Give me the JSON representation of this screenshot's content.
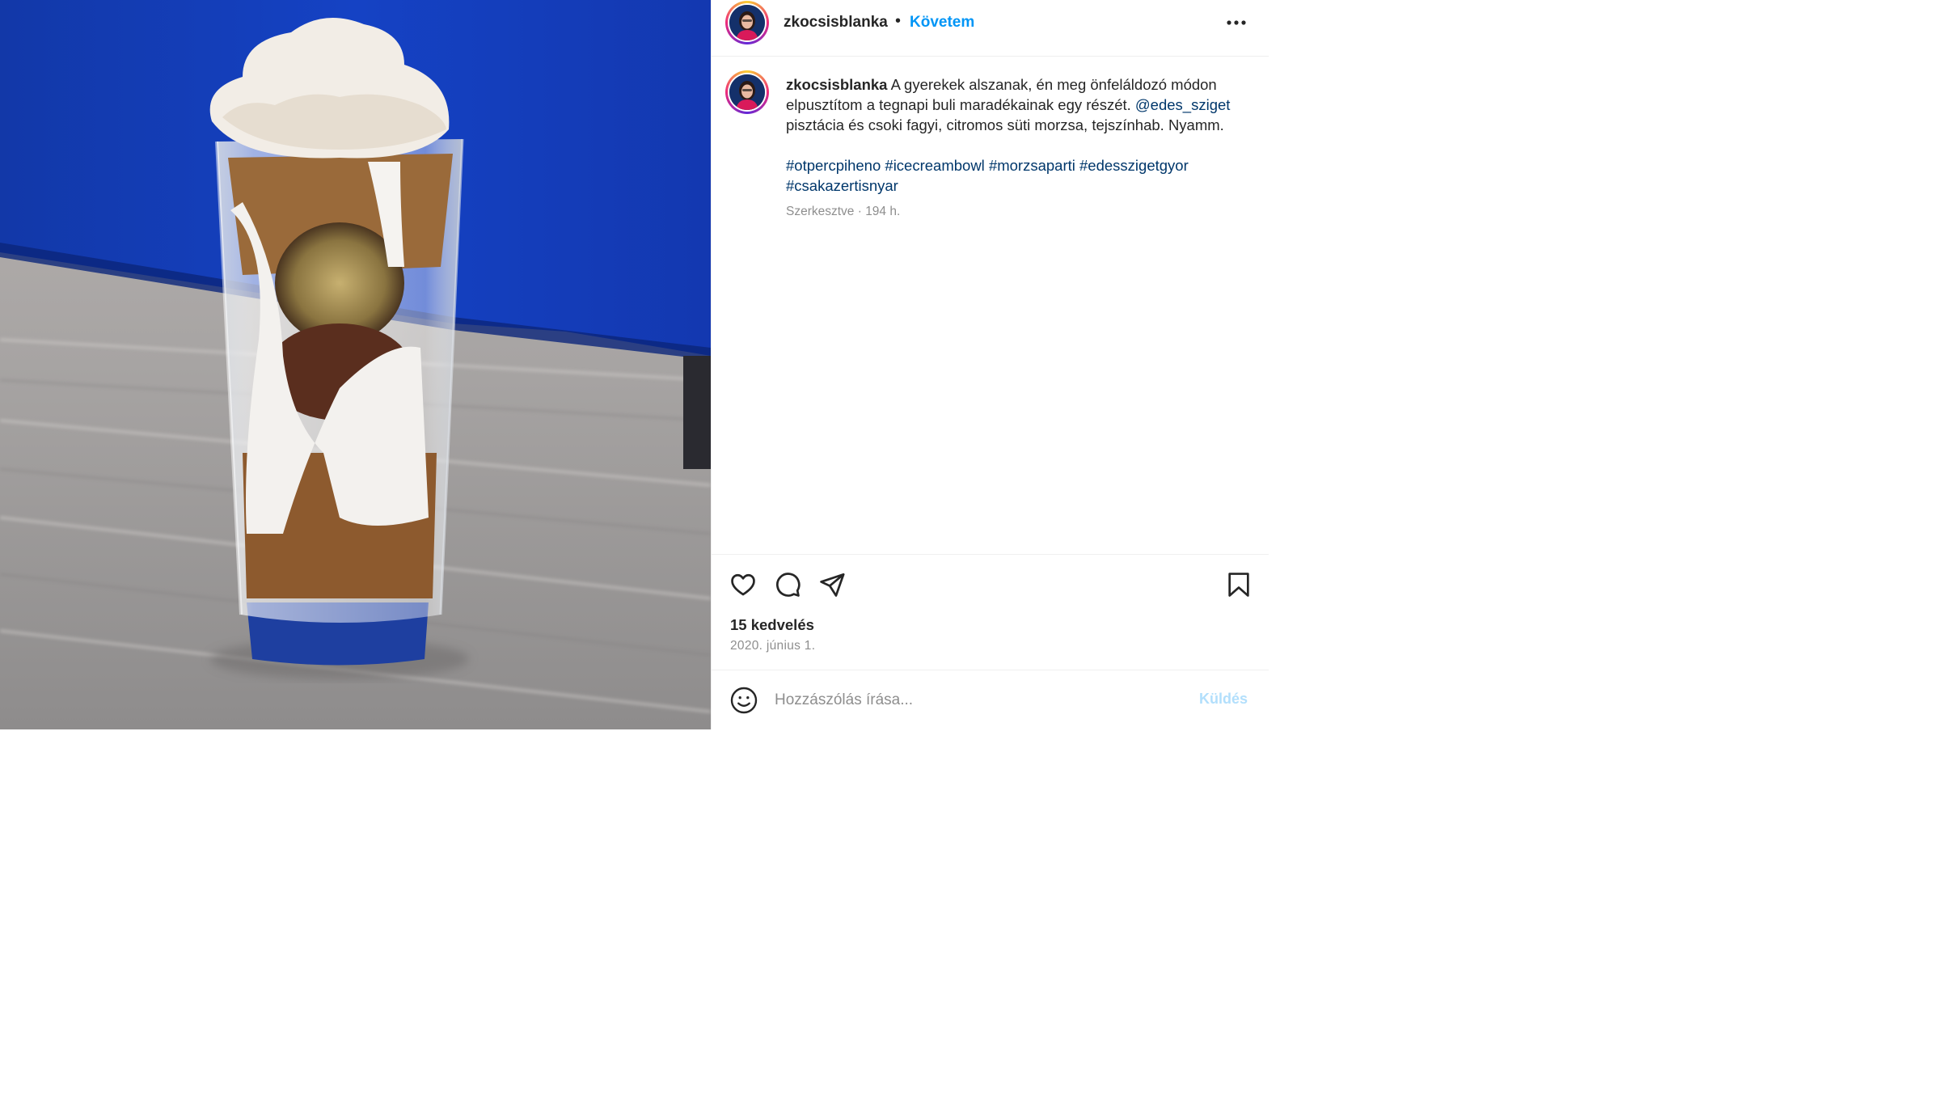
{
  "post": {
    "username": "zkocsisblanka",
    "follow_label": "Követem",
    "separator": "•",
    "caption": {
      "text_line": "A gyerekek alszanak, én meg önfeláldozó módon elpusztítom a tegnapi buli maradékainak egy részét.",
      "mention": "@edes_sziget",
      "text_after_mention": "pisztácia és csoki fagyi, citromos süti morzsa, tejszínhab. Nyamm.",
      "hashtags": [
        "#otpercpiheno",
        "#icecreambowl",
        "#morzsaparti",
        "#edesszigetgyor",
        "#csakazertisnyar"
      ],
      "meta": "Szerkesztve · 194 h."
    },
    "likes": "15 kedvelés",
    "date": "2020. június 1.",
    "comment": {
      "placeholder": "Hozzászólás írása...",
      "send_label": "Küldés"
    }
  },
  "icons": {
    "more": "more-options-icon",
    "like": "heart-icon",
    "comment": "comment-icon",
    "share": "share-icon",
    "save": "bookmark-icon",
    "emoji": "emoji-icon"
  },
  "colors": {
    "accent": "#0095f6",
    "link": "#00376b",
    "muted": "#8e8e8e",
    "send_disabled": "#b2dffc"
  }
}
